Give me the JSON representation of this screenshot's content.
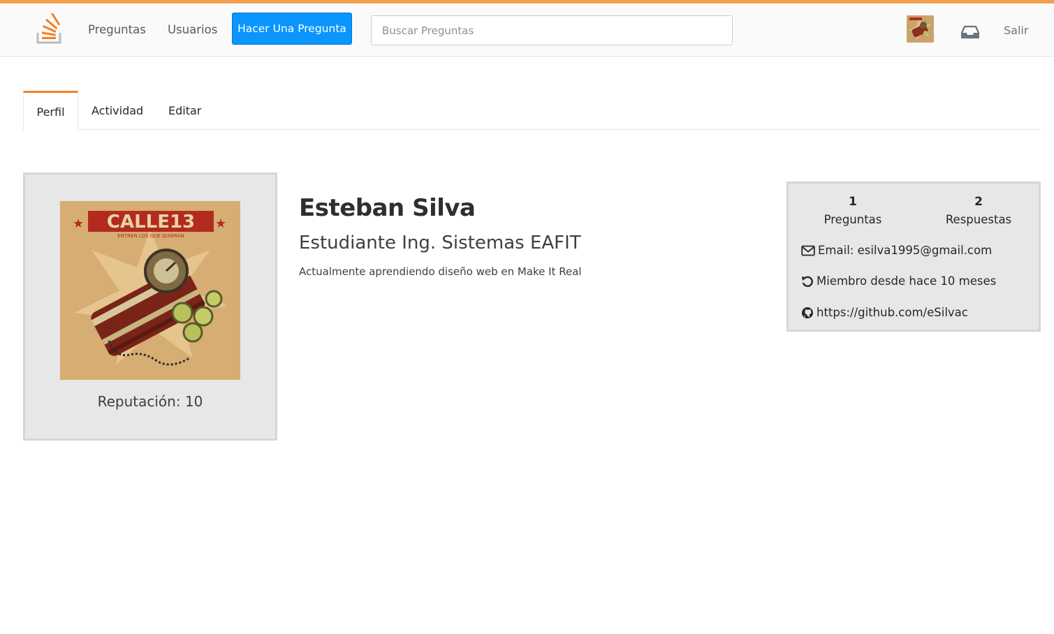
{
  "colors": {
    "accent": "#f48024",
    "topbar_accent": "#f2a050",
    "primary_button": "#0a95ff",
    "card_background": "#e8e7e8"
  },
  "header": {
    "logo_icon": "stackoverflow-logo-icon",
    "nav": {
      "preguntas": "Preguntas",
      "usuarios": "Usuarios"
    },
    "ask_button": "Hacer Una Pregunta",
    "search": {
      "placeholder": "Buscar Preguntas",
      "value": ""
    },
    "avatar_icon": "user-avatar",
    "inbox_icon": "inbox-icon",
    "logout": "Salir"
  },
  "tabs": [
    {
      "label": "Perfil",
      "active": true
    },
    {
      "label": "Actividad",
      "active": false
    },
    {
      "label": "Editar",
      "active": false
    }
  ],
  "profile": {
    "reputation_label": "Reputación: 10",
    "name": "Esteban Silva",
    "title": "Estudiante Ing. Sistemas EAFIT",
    "bio": "Actualmente aprendiendo diseño web en Make It Real",
    "album_art_text": "CALLE13",
    "album_art_subtext": "ENTREN LOS QUE QUIERAN"
  },
  "stats": {
    "questions": {
      "count": "1",
      "label": "Preguntas"
    },
    "answers": {
      "count": "2",
      "label": "Respuestas"
    },
    "email": "Email: esilva1995@gmail.com",
    "member_since": "Miembro desde hace 10 meses",
    "github": "https://github.com/eSilvac",
    "email_icon": "envelope-icon",
    "member_icon": "history-icon",
    "github_icon": "github-icon"
  }
}
